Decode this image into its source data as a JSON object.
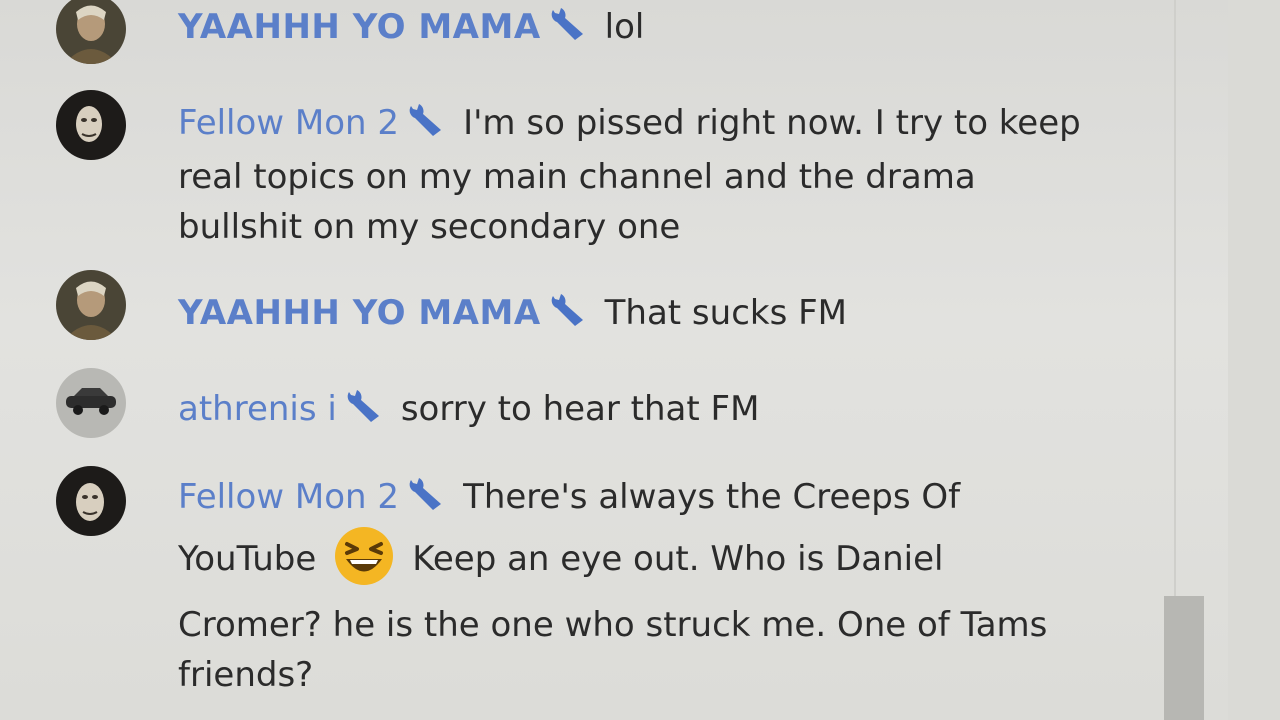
{
  "messages": [
    {
      "author": "YAAHHH YO MAMA",
      "text": "lol",
      "avatar": "portrait-avatar"
    },
    {
      "author": "Fellow Mon 2",
      "text": "I'm so pissed right now. I try to keep real topics on my main channel and the drama bullshit on my secondary one",
      "avatar": "dark-portrait-avatar"
    },
    {
      "author": "YAAHHH YO MAMA",
      "text": "That sucks FM",
      "avatar": "portrait-avatar"
    },
    {
      "author": "athrenis i",
      "text": "sorry to hear that FM",
      "avatar": "car-avatar"
    },
    {
      "author": "Fellow Mon 2",
      "text_before_emoji": "There's always the Creeps Of YouTube",
      "emoji": "laughing-emoji",
      "text_after_emoji": "Keep an eye out. Who is Daniel Cromer? he is the one who struck me. One of Tams friends?",
      "avatar": "dark-portrait-avatar"
    }
  ],
  "colors": {
    "author": "#5b7fc9",
    "moderator_icon": "#4a73c6",
    "text": "#2b2b2b"
  },
  "icons": {
    "moderator_badge": "wrench-icon"
  }
}
